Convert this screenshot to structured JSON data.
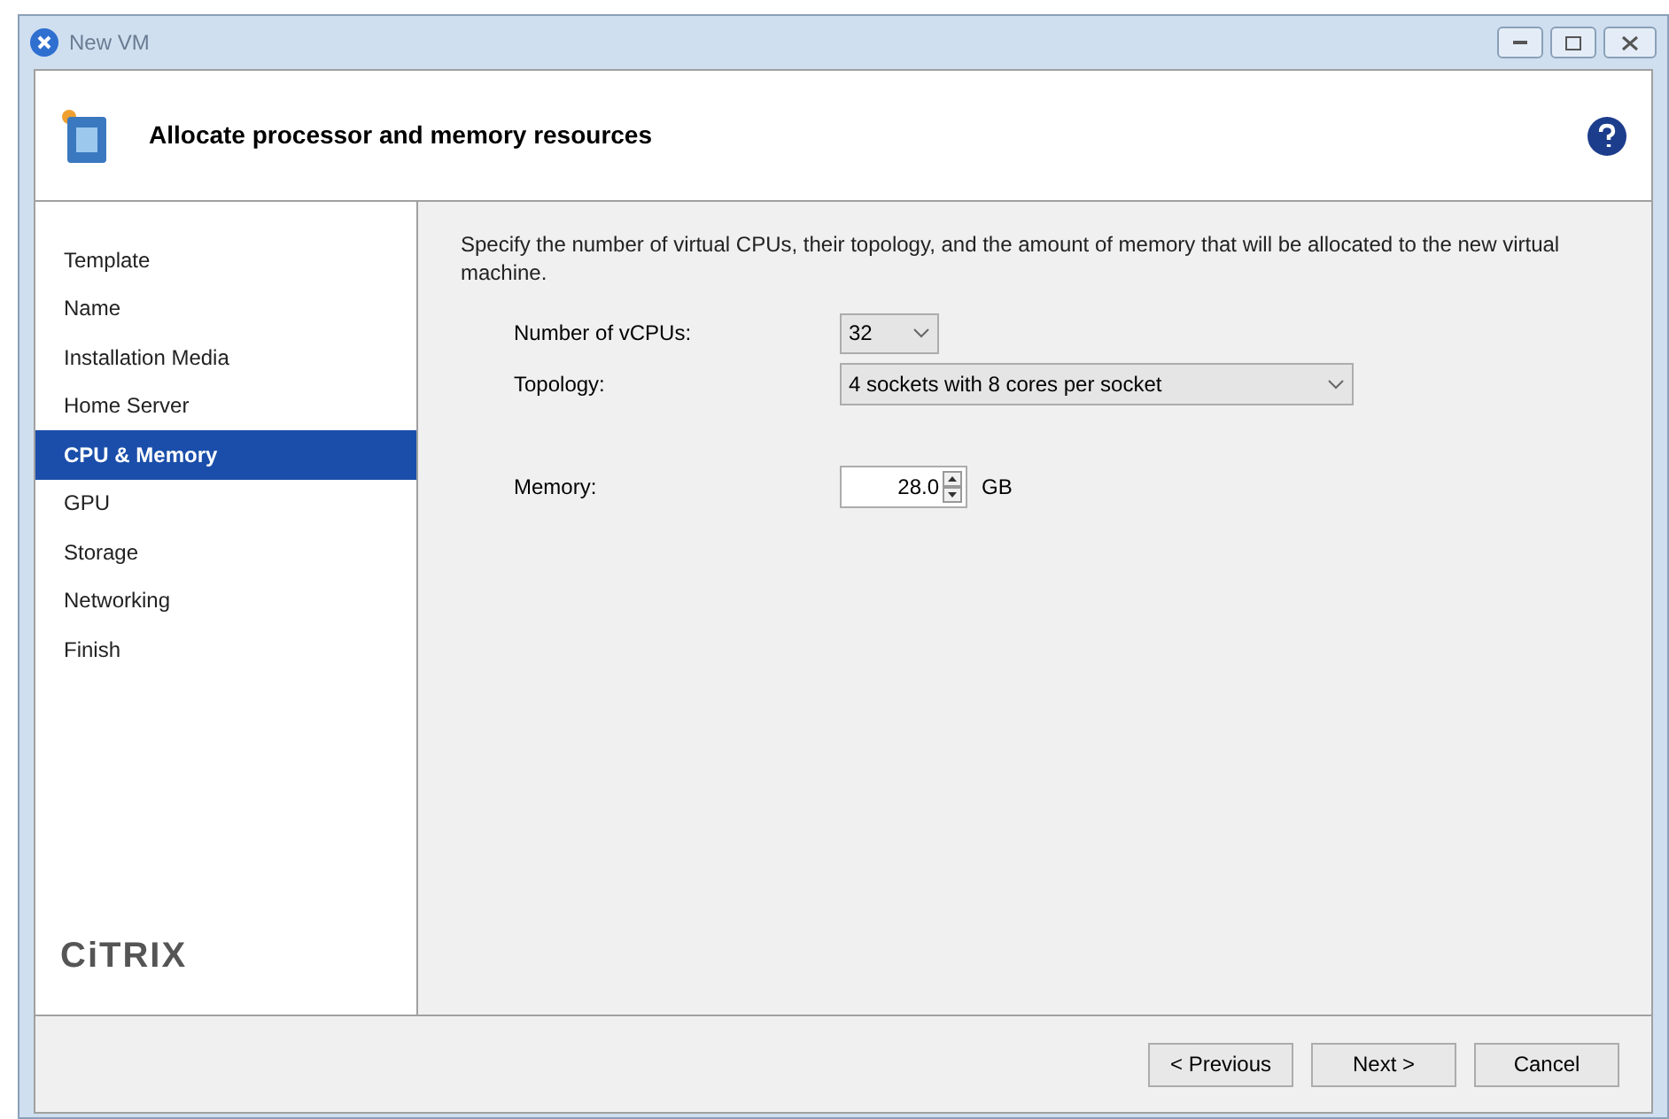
{
  "window": {
    "title": "New VM"
  },
  "header": {
    "title": "Allocate processor and memory resources"
  },
  "sidebar": {
    "items": [
      {
        "label": "Template",
        "selected": false
      },
      {
        "label": "Name",
        "selected": false
      },
      {
        "label": "Installation Media",
        "selected": false
      },
      {
        "label": "Home Server",
        "selected": false
      },
      {
        "label": "CPU & Memory",
        "selected": true
      },
      {
        "label": "GPU",
        "selected": false
      },
      {
        "label": "Storage",
        "selected": false
      },
      {
        "label": "Networking",
        "selected": false
      },
      {
        "label": "Finish",
        "selected": false
      }
    ],
    "logo": "CiTRIX"
  },
  "content": {
    "description": "Specify the number of virtual CPUs, their topology, and the amount of memory that will be allocated to the new virtual machine.",
    "vcpus": {
      "label": "Number of vCPUs:",
      "value": "32"
    },
    "topology": {
      "label": "Topology:",
      "value": "4 sockets with 8 cores per socket"
    },
    "memory": {
      "label": "Memory:",
      "value": "28.0",
      "unit": "GB"
    }
  },
  "buttons": [
    "< Previous",
    "Next >",
    "Cancel"
  ]
}
